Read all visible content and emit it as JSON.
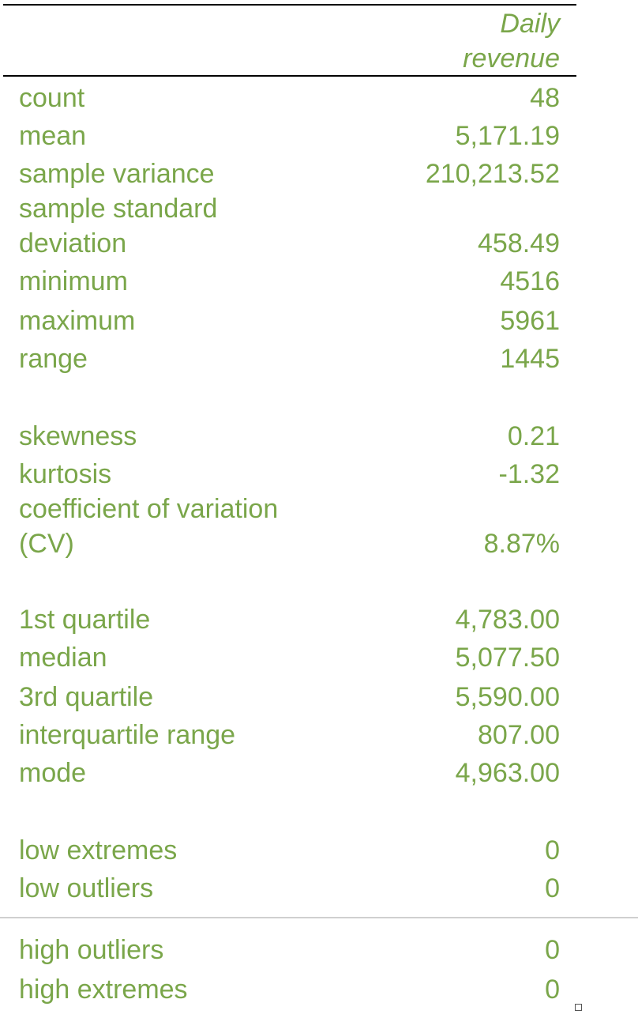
{
  "table": {
    "column_header": "Daily\nrevenue",
    "rows": [
      {
        "label": "count",
        "value": "48"
      },
      {
        "label": "mean",
        "value": "5,171.19"
      },
      {
        "label": "sample variance",
        "value": "210,213.52"
      },
      {
        "label": "sample standard\ndeviation",
        "value": "458.49"
      },
      {
        "label": "minimum",
        "value": "4516"
      },
      {
        "label": "maximum",
        "value": "5961"
      },
      {
        "label": "range",
        "value": "1445"
      },
      {
        "label": "skewness",
        "value": "0.21"
      },
      {
        "label": "kurtosis",
        "value": "-1.32"
      },
      {
        "label": "coefficient of variation\n(CV)",
        "value": "8.87%"
      },
      {
        "label": "1st quartile",
        "value": "4,783.00"
      },
      {
        "label": "median",
        "value": "5,077.50"
      },
      {
        "label": "3rd quartile",
        "value": "5,590.00"
      },
      {
        "label": "interquartile range",
        "value": "807.00"
      },
      {
        "label": "mode",
        "value": "4,963.00"
      },
      {
        "label": "low extremes",
        "value": "0"
      },
      {
        "label": "low outliers",
        "value": "0"
      },
      {
        "label": "high outliers",
        "value": "0"
      },
      {
        "label": "high extremes",
        "value": "0"
      }
    ]
  },
  "colors": {
    "text": "#7aa64a",
    "rule": "#000000",
    "separator": "#cfcfcf",
    "caption": "#e08a4f"
  }
}
